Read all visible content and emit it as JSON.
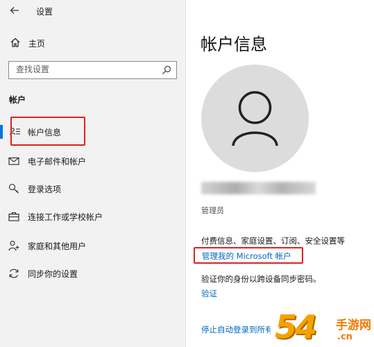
{
  "window": {
    "title": "设置"
  },
  "sidebar": {
    "home_label": "主页",
    "search_placeholder": "查找设置",
    "section_title": "帐户",
    "items": [
      {
        "label": "帐户信息",
        "icon": "person-list-icon",
        "active": true
      },
      {
        "label": "电子邮件和帐户",
        "icon": "mail-icon"
      },
      {
        "label": "登录选项",
        "icon": "key-icon"
      },
      {
        "label": "连接工作或学校帐户",
        "icon": "briefcase-icon"
      },
      {
        "label": "家庭和其他用户",
        "icon": "person-add-icon"
      },
      {
        "label": "同步你的设置",
        "icon": "sync-icon"
      }
    ]
  },
  "main": {
    "title": "帐户信息",
    "role": "管理员",
    "billing_info": "付费信息、家庭设置、订阅、安全设置等",
    "manage_link": "管理我的 Microsoft 帐户",
    "verify_text": "验证你的身份以跨设备同步密码。",
    "verify_link": "验证",
    "stop_signin_link": "停止自动登录到所有"
  },
  "watermark": {
    "digits": "54",
    "cn": "手游网",
    "domain": ".cn"
  },
  "colors": {
    "accent": "#0078d7",
    "link": "#0067c0",
    "highlight": "#e02020"
  }
}
